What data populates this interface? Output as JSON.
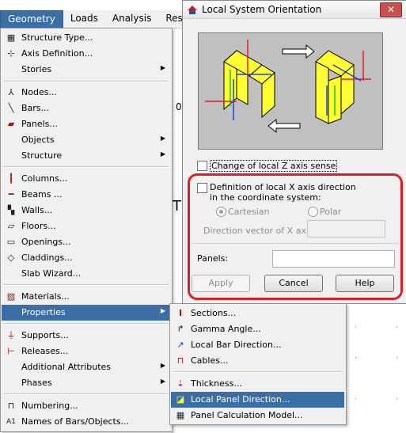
{
  "menubar": {
    "items": [
      "Geometry",
      "Loads",
      "Analysis",
      "Resu"
    ]
  },
  "geometry_menu": {
    "items": [
      {
        "label": "Structure Type...",
        "icon": "structure-type-icon",
        "glyph": "▦"
      },
      {
        "label": "Axis Definition...",
        "icon": "axis-definition-icon",
        "glyph": "⊹"
      },
      {
        "label": "Stories",
        "submenu": true
      },
      {
        "label": "Nodes...",
        "icon": "nodes-icon",
        "glyph": "⅄"
      },
      {
        "label": "Bars...",
        "icon": "bars-icon",
        "glyph": "╲"
      },
      {
        "label": "Panels...",
        "icon": "panels-icon",
        "glyph": "▰"
      },
      {
        "label": "Objects",
        "submenu": true
      },
      {
        "label": "Structure",
        "submenu": true
      },
      {
        "label": "Columns...",
        "icon": "columns-icon",
        "glyph": "┃"
      },
      {
        "label": "Beams ...",
        "icon": "beams-icon",
        "glyph": "━"
      },
      {
        "label": "Walls...",
        "icon": "walls-icon",
        "glyph": "▚"
      },
      {
        "label": "Floors...",
        "icon": "floors-icon",
        "glyph": "▱"
      },
      {
        "label": "Openings...",
        "icon": "openings-icon",
        "glyph": "▭"
      },
      {
        "label": "Claddings...",
        "icon": "claddings-icon",
        "glyph": "◇"
      },
      {
        "label": "Slab Wizard...",
        "icon": "",
        "glyph": ""
      },
      {
        "label": "Materials...",
        "icon": "materials-icon",
        "glyph": "▨"
      },
      {
        "label": "Properties",
        "submenu": true
      },
      {
        "label": "Supports...",
        "icon": "supports-icon",
        "glyph": "⏚"
      },
      {
        "label": "Releases...",
        "icon": "releases-icon",
        "glyph": "⊢"
      },
      {
        "label": "Additional Attributes",
        "submenu": true
      },
      {
        "label": "Phases",
        "submenu": true
      },
      {
        "label": "Numbering...",
        "icon": "numbering-icon",
        "glyph": "⊓"
      },
      {
        "label": "Names of Bars/Objects...",
        "icon": "names-icon",
        "glyph": "A1"
      }
    ]
  },
  "properties_menu": {
    "items": [
      {
        "label": "Sections...",
        "icon": "sections-icon",
        "glyph": "I"
      },
      {
        "label": "Gamma Angle...",
        "icon": "gamma-angle-icon",
        "glyph": "↱"
      },
      {
        "label": "Local Bar Direction...",
        "icon": "local-bar-direction-icon",
        "glyph": "↗"
      },
      {
        "label": "Cables...",
        "icon": "cables-icon",
        "glyph": "⊓"
      },
      {
        "label": "Thickness...",
        "icon": "thickness-icon",
        "glyph": "⇣"
      },
      {
        "label": "Local Panel Direction...",
        "icon": "local-panel-direction-icon",
        "glyph": "◪"
      },
      {
        "label": "Panel Calculation Model...",
        "icon": "panel-calculation-model-icon",
        "glyph": "▦"
      }
    ]
  },
  "dialog": {
    "title": "Local System Orientation",
    "close": "✕",
    "change_z_label": "Change of local Z axis sense",
    "def_x_label_1": "Definition of local X axis direction",
    "def_x_label_2": "in the coordinate system:",
    "cartesian_label": "Cartesian",
    "polar_label": "Polar",
    "direction_vector_label": "Direction vector of X axis:",
    "direction_vector_value": "",
    "panels_label": "Panels:",
    "panels_value": "",
    "apply_label": "Apply",
    "cancel_label": "Cancel",
    "help_label": "Help"
  },
  "background": {
    "fragment": "0"
  },
  "colors": {
    "menu_highlight": "#3a6ea5",
    "callout_red": "#d9202a",
    "panel_yellow": "#ffff33"
  }
}
